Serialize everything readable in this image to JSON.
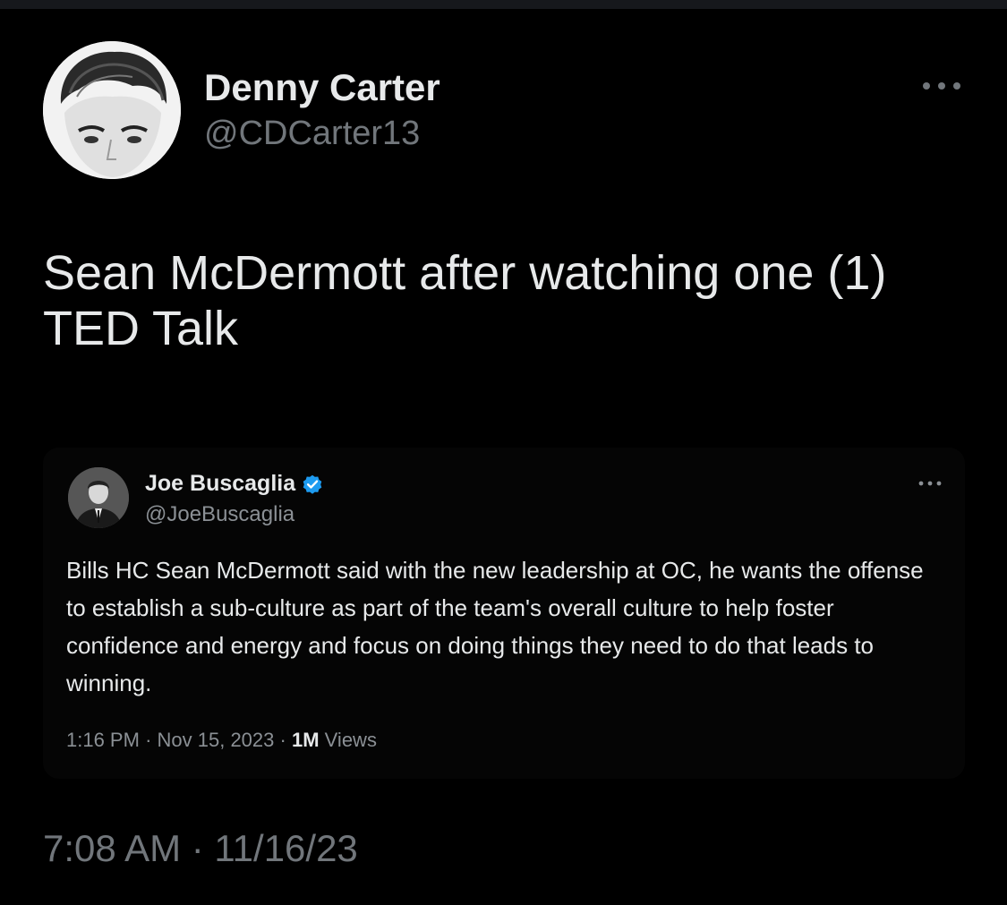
{
  "author": {
    "name": "Denny Carter",
    "handle": "@CDCarter13"
  },
  "tweet": {
    "text": "Sean McDermott after watching one (1) TED Talk",
    "timestamp": "7:08 AM · 11/16/23"
  },
  "quoted_tweet": {
    "name": "Joe Buscaglia",
    "handle": "@JoeBuscaglia",
    "verified": true,
    "text": "Bills HC Sean McDermott said with the new leadership at OC, he wants the offense to establish a sub-culture as part of the team's overall culture to help foster confidence and energy and focus on doing things they need to do that leads to winning.",
    "time": "1:16 PM",
    "date": "Nov 15, 2023",
    "views_count": "1M",
    "views_label": "Views",
    "separator": "·"
  },
  "colors": {
    "background": "#000000",
    "primary_text": "#e7e9ea",
    "secondary_text": "#71767b",
    "verified_badge": "#1d9bf0"
  },
  "icons": {
    "more": "more-horizontal-icon",
    "verified": "verified-badge-icon"
  }
}
